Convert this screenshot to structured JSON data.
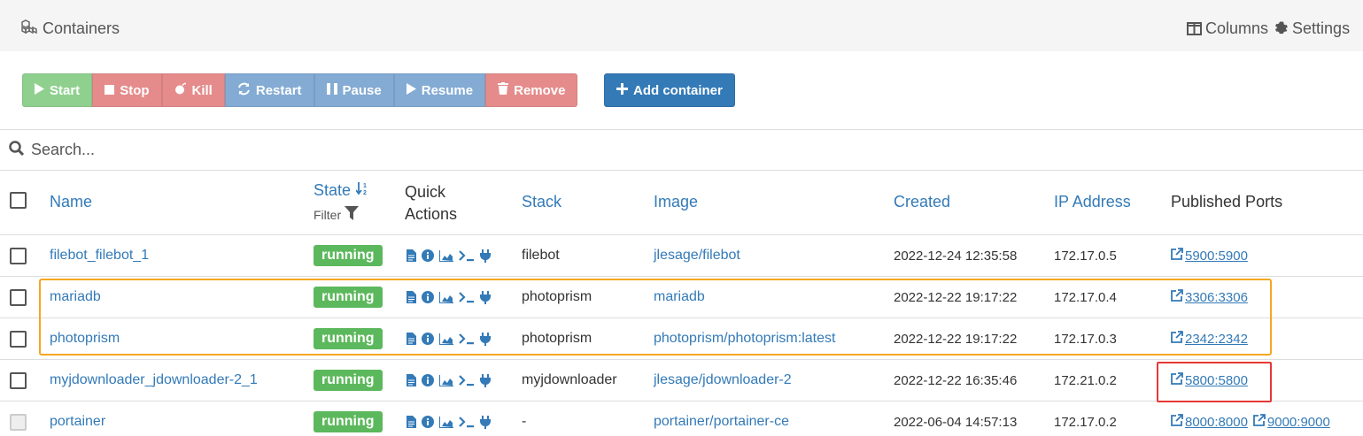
{
  "header": {
    "title": "Containers",
    "columns_label": "Columns",
    "settings_label": "Settings"
  },
  "toolbar": {
    "start": "Start",
    "stop": "Stop",
    "kill": "Kill",
    "restart": "Restart",
    "pause": "Pause",
    "resume": "Resume",
    "remove": "Remove",
    "add_container": "Add container"
  },
  "search": {
    "placeholder": "Search..."
  },
  "table": {
    "headers": {
      "name": "Name",
      "state": "State",
      "filter": "Filter",
      "quick_actions_1": "Quick",
      "quick_actions_2": "Actions",
      "stack": "Stack",
      "image": "Image",
      "created": "Created",
      "ip": "IP Address",
      "ports": "Published Ports"
    },
    "rows": [
      {
        "name": "filebot_filebot_1",
        "state": "running",
        "stack": "filebot",
        "image": "jlesage/filebot",
        "created": "2022-12-24 12:35:58",
        "ip": "172.17.0.5",
        "ports": [
          "5900:5900"
        ]
      },
      {
        "name": "mariadb",
        "state": "running",
        "stack": "photoprism",
        "image": "mariadb",
        "created": "2022-12-22 19:17:22",
        "ip": "172.17.0.4",
        "ports": [
          "3306:3306"
        ]
      },
      {
        "name": "photoprism",
        "state": "running",
        "stack": "photoprism",
        "image": "photoprism/photoprism:latest",
        "created": "2022-12-22 19:17:22",
        "ip": "172.17.0.3",
        "ports": [
          "2342:2342"
        ]
      },
      {
        "name": "myjdownloader_jdownloader-2_1",
        "state": "running",
        "stack": "myjdownloader",
        "image": "jlesage/jdownloader-2",
        "created": "2022-12-22 16:35:46",
        "ip": "172.21.0.2",
        "ports": [
          "5800:5800"
        ]
      },
      {
        "name": "portainer",
        "state": "running",
        "stack": "-",
        "image": "portainer/portainer-ce",
        "created": "2022-06-04 14:57:13",
        "ip": "172.17.0.2",
        "ports": [
          "8000:8000",
          "9000:9000"
        ]
      }
    ]
  },
  "colors": {
    "accent": "#337ab7",
    "running": "#5cb85c",
    "highlight_orange": "#f5a623",
    "highlight_red": "#e53935"
  }
}
